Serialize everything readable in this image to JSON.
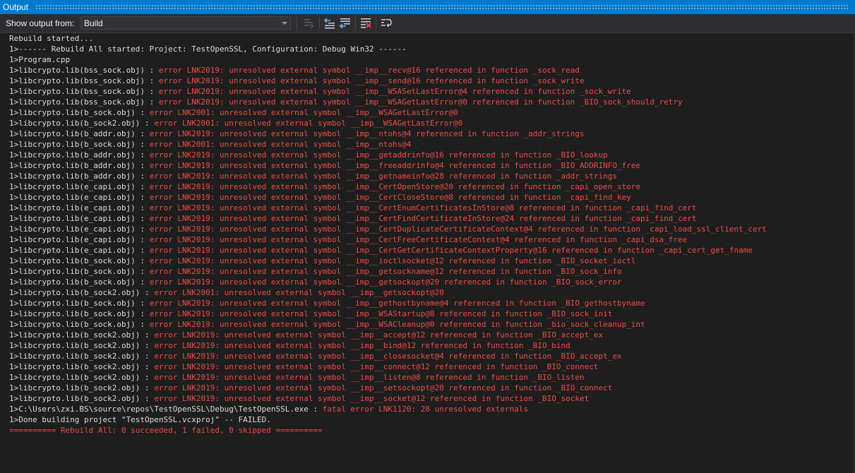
{
  "window": {
    "title": "Output"
  },
  "toolbar": {
    "show_output_label": "Show output from:",
    "source_selected": "Build",
    "buttons": [
      {
        "name": "find-message-in-code-button",
        "icon": "goto-code-icon",
        "enabled": false
      },
      {
        "name": "go-to-previous-message-button",
        "icon": "previous-message-icon",
        "enabled": true
      },
      {
        "name": "go-to-next-message-button",
        "icon": "next-message-icon",
        "enabled": true
      },
      {
        "name": "clear-all-button",
        "icon": "clear-all-icon",
        "enabled": true
      },
      {
        "name": "toggle-word-wrap-button",
        "icon": "word-wrap-icon",
        "enabled": true
      }
    ]
  },
  "colors": {
    "title_bar": "#007acc",
    "background": "#1e1e1e",
    "normal_text": "#dcdcdc",
    "error_text": "#ec4c47"
  },
  "output": {
    "lines": [
      {
        "segments": [
          {
            "text": "Rebuild started...",
            "style": "white"
          }
        ]
      },
      {
        "segments": [
          {
            "text": "1>------ Rebuild All started: Project: TestOpenSSL, Configuration: Debug Win32 ------",
            "style": "white"
          }
        ]
      },
      {
        "segments": [
          {
            "text": "1>Program.cpp",
            "style": "white"
          }
        ]
      },
      {
        "segments": [
          {
            "text": "1>libcrypto.lib(bss_sock.obj) : ",
            "style": "white"
          },
          {
            "text": "error LNK2019: unresolved external symbol __imp__recv@16 referenced in function _sock_read",
            "style": "red"
          }
        ]
      },
      {
        "segments": [
          {
            "text": "1>libcrypto.lib(bss_sock.obj) : ",
            "style": "white"
          },
          {
            "text": "error LNK2019: unresolved external symbol __imp__send@16 referenced in function _sock_write",
            "style": "red"
          }
        ]
      },
      {
        "segments": [
          {
            "text": "1>libcrypto.lib(bss_sock.obj) : ",
            "style": "white"
          },
          {
            "text": "error LNK2019: unresolved external symbol __imp__WSASetLastError@4 referenced in function _sock_write",
            "style": "red"
          }
        ]
      },
      {
        "segments": [
          {
            "text": "1>libcrypto.lib(bss_sock.obj) : ",
            "style": "white"
          },
          {
            "text": "error LNK2019: unresolved external symbol __imp__WSAGetLastError@0 referenced in function _BIO_sock_should_retry",
            "style": "red"
          }
        ]
      },
      {
        "segments": [
          {
            "text": "1>libcrypto.lib(b_sock.obj) : ",
            "style": "white"
          },
          {
            "text": "error LNK2001: unresolved external symbol __imp__WSAGetLastError@0",
            "style": "red"
          }
        ]
      },
      {
        "segments": [
          {
            "text": "1>libcrypto.lib(b_sock2.obj) : ",
            "style": "white"
          },
          {
            "text": "error LNK2001: unresolved external symbol __imp__WSAGetLastError@0",
            "style": "red"
          }
        ]
      },
      {
        "segments": [
          {
            "text": "1>libcrypto.lib(b_addr.obj) : ",
            "style": "white"
          },
          {
            "text": "error LNK2019: unresolved external symbol __imp__ntohs@4 referenced in function _addr_strings",
            "style": "red"
          }
        ]
      },
      {
        "segments": [
          {
            "text": "1>libcrypto.lib(b_sock.obj) : ",
            "style": "white"
          },
          {
            "text": "error LNK2001: unresolved external symbol __imp__ntohs@4",
            "style": "red"
          }
        ]
      },
      {
        "segments": [
          {
            "text": "1>libcrypto.lib(b_addr.obj) : ",
            "style": "white"
          },
          {
            "text": "error LNK2019: unresolved external symbol __imp__getaddrinfo@16 referenced in function _BIO_lookup",
            "style": "red"
          }
        ]
      },
      {
        "segments": [
          {
            "text": "1>libcrypto.lib(b_addr.obj) : ",
            "style": "white"
          },
          {
            "text": "error LNK2019: unresolved external symbol __imp__freeaddrinfo@4 referenced in function _BIO_ADDRINFO_free",
            "style": "red"
          }
        ]
      },
      {
        "segments": [
          {
            "text": "1>libcrypto.lib(b_addr.obj) : ",
            "style": "white"
          },
          {
            "text": "error LNK2019: unresolved external symbol __imp__getnameinfo@28 referenced in function _addr_strings",
            "style": "red"
          }
        ]
      },
      {
        "segments": [
          {
            "text": "1>libcrypto.lib(e_capi.obj) : ",
            "style": "white"
          },
          {
            "text": "error LNK2019: unresolved external symbol __imp__CertOpenStore@20 referenced in function _capi_open_store",
            "style": "red"
          }
        ]
      },
      {
        "segments": [
          {
            "text": "1>libcrypto.lib(e_capi.obj) : ",
            "style": "white"
          },
          {
            "text": "error LNK2019: unresolved external symbol __imp__CertCloseStore@8 referenced in function _capi_find_key",
            "style": "red"
          }
        ]
      },
      {
        "segments": [
          {
            "text": "1>libcrypto.lib(e_capi.obj) : ",
            "style": "white"
          },
          {
            "text": "error LNK2019: unresolved external symbol __imp__CertEnumCertificatesInStore@8 referenced in function _capi_find_cert",
            "style": "red"
          }
        ]
      },
      {
        "segments": [
          {
            "text": "1>libcrypto.lib(e_capi.obj) : ",
            "style": "white"
          },
          {
            "text": "error LNK2019: unresolved external symbol __imp__CertFindCertificateInStore@24 referenced in function _capi_find_cert",
            "style": "red"
          }
        ]
      },
      {
        "segments": [
          {
            "text": "1>libcrypto.lib(e_capi.obj) : ",
            "style": "white"
          },
          {
            "text": "error LNK2019: unresolved external symbol __imp__CertDuplicateCertificateContext@4 referenced in function _capi_load_ssl_client_cert",
            "style": "red"
          }
        ]
      },
      {
        "segments": [
          {
            "text": "1>libcrypto.lib(e_capi.obj) : ",
            "style": "white"
          },
          {
            "text": "error LNK2019: unresolved external symbol __imp__CertFreeCertificateContext@4 referenced in function _capi_dsa_free",
            "style": "red"
          }
        ]
      },
      {
        "segments": [
          {
            "text": "1>libcrypto.lib(e_capi.obj) : ",
            "style": "white"
          },
          {
            "text": "error LNK2019: unresolved external symbol __imp__CertGetCertificateContextProperty@16 referenced in function _capi_cert_get_fname",
            "style": "red"
          }
        ]
      },
      {
        "segments": [
          {
            "text": "1>libcrypto.lib(b_sock.obj) : ",
            "style": "white"
          },
          {
            "text": "error LNK2019: unresolved external symbol __imp__ioctlsocket@12 referenced in function _BIO_socket_ioctl",
            "style": "red"
          }
        ]
      },
      {
        "segments": [
          {
            "text": "1>libcrypto.lib(b_sock.obj) : ",
            "style": "white"
          },
          {
            "text": "error LNK2019: unresolved external symbol __imp__getsockname@12 referenced in function _BIO_sock_info",
            "style": "red"
          }
        ]
      },
      {
        "segments": [
          {
            "text": "1>libcrypto.lib(b_sock.obj) : ",
            "style": "white"
          },
          {
            "text": "error LNK2019: unresolved external symbol __imp__getsockopt@20 referenced in function _BIO_sock_error",
            "style": "red"
          }
        ]
      },
      {
        "segments": [
          {
            "text": "1>libcrypto.lib(b_sock2.obj) : ",
            "style": "white"
          },
          {
            "text": "error LNK2001: unresolved external symbol __imp__getsockopt@20",
            "style": "red"
          }
        ]
      },
      {
        "segments": [
          {
            "text": "1>libcrypto.lib(b_sock.obj) : ",
            "style": "white"
          },
          {
            "text": "error LNK2019: unresolved external symbol __imp__gethostbyname@4 referenced in function _BIO_gethostbyname",
            "style": "red"
          }
        ]
      },
      {
        "segments": [
          {
            "text": "1>libcrypto.lib(b_sock.obj) : ",
            "style": "white"
          },
          {
            "text": "error LNK2019: unresolved external symbol __imp__WSAStartup@8 referenced in function _BIO_sock_init",
            "style": "red"
          }
        ]
      },
      {
        "segments": [
          {
            "text": "1>libcrypto.lib(b_sock.obj) : ",
            "style": "white"
          },
          {
            "text": "error LNK2019: unresolved external symbol __imp__WSACleanup@0 referenced in function _bio_sock_cleanup_int",
            "style": "red"
          }
        ]
      },
      {
        "segments": [
          {
            "text": "1>libcrypto.lib(b_sock2.obj) : ",
            "style": "white"
          },
          {
            "text": "error LNK2019: unresolved external symbol __imp__accept@12 referenced in function _BIO_accept_ex",
            "style": "red"
          }
        ]
      },
      {
        "segments": [
          {
            "text": "1>libcrypto.lib(b_sock2.obj) : ",
            "style": "white"
          },
          {
            "text": "error LNK2019: unresolved external symbol __imp__bind@12 referenced in function _BIO_bind",
            "style": "red"
          }
        ]
      },
      {
        "segments": [
          {
            "text": "1>libcrypto.lib(b_sock2.obj) : ",
            "style": "white"
          },
          {
            "text": "error LNK2019: unresolved external symbol __imp__closesocket@4 referenced in function _BIO_accept_ex",
            "style": "red"
          }
        ]
      },
      {
        "segments": [
          {
            "text": "1>libcrypto.lib(b_sock2.obj) : ",
            "style": "white"
          },
          {
            "text": "error LNK2019: unresolved external symbol __imp__connect@12 referenced in function _BIO_connect",
            "style": "red"
          }
        ]
      },
      {
        "segments": [
          {
            "text": "1>libcrypto.lib(b_sock2.obj) : ",
            "style": "white"
          },
          {
            "text": "error LNK2019: unresolved external symbol __imp__listen@8 referenced in function _BIO_listen",
            "style": "red"
          }
        ]
      },
      {
        "segments": [
          {
            "text": "1>libcrypto.lib(b_sock2.obj) : ",
            "style": "white"
          },
          {
            "text": "error LNK2019: unresolved external symbol __imp__setsockopt@20 referenced in function _BIO_connect",
            "style": "red"
          }
        ]
      },
      {
        "segments": [
          {
            "text": "1>libcrypto.lib(b_sock2.obj) : ",
            "style": "white"
          },
          {
            "text": "error LNK2019: unresolved external symbol __imp__socket@12 referenced in function _BIO_socket",
            "style": "red"
          }
        ]
      },
      {
        "segments": [
          {
            "text": "1>C:\\Users\\zxi.BS\\source\\repos\\TestOpenSSL\\Debug\\TestOpenSSL.exe : ",
            "style": "white"
          },
          {
            "text": "fatal error LNK1120: 28 unresolved externals",
            "style": "red"
          }
        ]
      },
      {
        "segments": [
          {
            "text": "1>Done building project \"TestOpenSSL.vcxproj\" -- FAILED.",
            "style": "white"
          }
        ]
      },
      {
        "segments": [
          {
            "text": "========== Rebuild All: 0 succeeded, 1 failed, 0 skipped ==========",
            "style": "red"
          }
        ]
      }
    ]
  }
}
